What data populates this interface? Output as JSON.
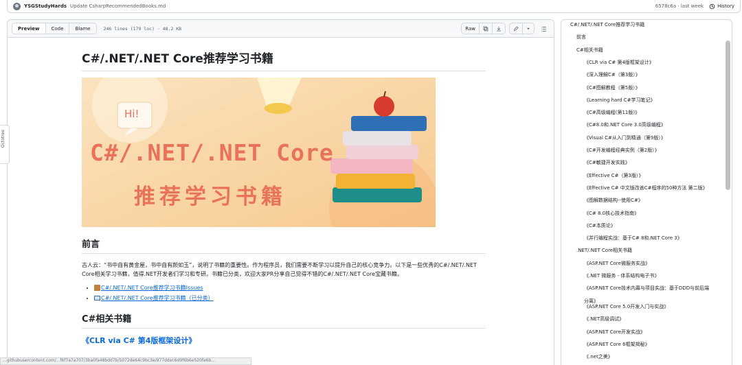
{
  "commit": {
    "user": "YSGStudyHards",
    "message": "Update CsharpRecommendedBooks.md",
    "hash_time": "6578c6a · last week",
    "history_label": "History"
  },
  "file_header": {
    "tabs": [
      "Preview",
      "Code",
      "Blame"
    ],
    "meta": "246 lines (179 loc) · 48.2 KB",
    "raw_label": "Raw"
  },
  "readme": {
    "title": "C#/.NET/.NET Core推荐学习书籍",
    "banner": {
      "hi": "Hi!",
      "line1": "C#/.NET/.NET Core",
      "line2": "推荐学习书籍"
    },
    "section_preface": "前言",
    "preface_text": "古人云：“书中自有黄金屋，书中自有颜如玉”，说明了书籍的重要性。作为程序员，我们需要不断学习以提升自己的核心竞争力。以下是一些优秀的C#/.NET/.NET Core相关学习书籍，值得.NET开发者们学习和专研。书籍已分类，欢迎大家PR分享自己觉得不错的C#/.NET/.NET Core宝藏书籍。",
    "links": [
      "C#/.NET/.NET Core推荐学习书籍Issues",
      "C#/.NET/.NET Core推荐学习书籍（已分类）"
    ],
    "section_csharp": "C#相关书籍",
    "first_book": "《CLR via C# 第4版框架设计》"
  },
  "outline": {
    "items": [
      {
        "level": 1,
        "text": "C#/.NET/.NET Core推荐学习书籍"
      },
      {
        "level": 2,
        "text": "前言"
      },
      {
        "level": 2,
        "text": "C#相关书籍"
      },
      {
        "level": 3,
        "text": "《CLR via C# 第4版框架设计》"
      },
      {
        "level": 3,
        "text": "《深入理解C#（第3版）》"
      },
      {
        "level": 3,
        "text": "《C#图解教程（第5版）》"
      },
      {
        "level": 3,
        "text": "《Learning hard C#学习笔记》"
      },
      {
        "level": 3,
        "text": "《C#高级编程(第11版)》"
      },
      {
        "level": 3,
        "text": "《C#8.0和.NET Core 3.0高级编程》"
      },
      {
        "level": 3,
        "text": "《Visual C#从入门到精通（第9版）》"
      },
      {
        "level": 3,
        "text": "《C#开发编程经典实例（第2版）》"
      },
      {
        "level": 3,
        "text": "《C#敏捷开发实践》"
      },
      {
        "level": 3,
        "text": "《Effective C#（第3版）》"
      },
      {
        "level": 3,
        "text": "《Effective C# 中文版改善C#程序的50种方法 第二版》"
      },
      {
        "level": 3,
        "text": "《图解数据结构--使用C#》"
      },
      {
        "level": 3,
        "text": "《C# 8.0核心技术指南》"
      },
      {
        "level": 3,
        "text": "《C#本质论》"
      },
      {
        "level": 3,
        "text": "《并行编程实战：基于C# 8和.NET Core 3》"
      },
      {
        "level": 2,
        "text": ".NET/.NET Core相关书籍"
      },
      {
        "level": 3,
        "text": "《ASP.NET Core微服务实战》"
      },
      {
        "level": 3,
        "text": "《.NET 微服务 - 体系结构电子书》"
      },
      {
        "level": 3,
        "text": "《ASP.NET Core技术内幕与项目实战：基于DDD与前后端"
      },
      {
        "level": 3,
        "text": "分离》"
      },
      {
        "level": 3,
        "text": "《ASP.NET Core 5.0开发入门与实战》"
      },
      {
        "level": 3,
        "text": "《.NET高级调试》"
      },
      {
        "level": 3,
        "text": "《ASP.NET Core开发实战》"
      },
      {
        "level": 3,
        "text": "《ASP.NET Core 6框架揭秘》"
      },
      {
        "level": 3,
        "text": "《.net之美》"
      }
    ]
  },
  "octotree_label": "Octotree",
  "status_url": "...githubusercontent.com/...f6f7a7a707/3ba0fa48bdd7b/5072de64c9bc3e/977ddec6d9f6b6e520fe6b...",
  "colors": {
    "link": "#0969da",
    "border": "#d0d7de",
    "banner_text": "#e8735a"
  }
}
